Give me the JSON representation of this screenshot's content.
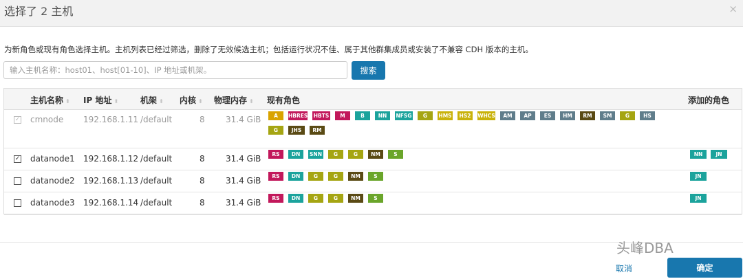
{
  "dialog": {
    "title": "选择了 2 主机",
    "close_icon": "×"
  },
  "description": "为新角色或现有角色选择主机。主机列表已经过筛选，删除了无效候选主机；包括运行状况不佳、属于其他群集成员或安装了不兼容 CDH 版本的主机。",
  "search": {
    "placeholder": "输入主机名称：host01、host[01-10]、IP 地址或机架。",
    "value": "",
    "button": "搜索"
  },
  "table": {
    "headers": {
      "hostname": "主机名称",
      "ip": "IP 地址",
      "rack": "机架",
      "cores": "内核",
      "memory": "物理内存",
      "existing_roles": "现有角色",
      "added_roles": "添加的角色"
    },
    "sort_icon": "⬍",
    "rows": [
      {
        "checked": true,
        "disabled": true,
        "hostname": "cmnode",
        "ip": "192.168.1.11",
        "rack": "/default",
        "cores": "8",
        "memory": "31.4 GiB",
        "roles": [
          "A",
          "HBRES",
          "HBTS",
          "M",
          "B",
          "NN",
          "NFSG",
          "G",
          "HMS",
          "HS2",
          "WHCS",
          "AM",
          "AP",
          "ES",
          "HM",
          "RM",
          "SM",
          "G",
          "HS",
          "G",
          "JHS",
          "RM"
        ],
        "added": []
      },
      {
        "checked": true,
        "disabled": false,
        "hostname": "datanode1",
        "ip": "192.168.1.12",
        "rack": "/default",
        "cores": "8",
        "memory": "31.4 GiB",
        "roles": [
          "RS",
          "DN",
          "SNN",
          "G",
          "G",
          "NM",
          "S"
        ],
        "added": [
          "NN",
          "JN"
        ]
      },
      {
        "checked": false,
        "disabled": false,
        "hostname": "datanode2",
        "ip": "192.168.1.13",
        "rack": "/default",
        "cores": "8",
        "memory": "31.4 GiB",
        "roles": [
          "RS",
          "DN",
          "G",
          "G",
          "NM",
          "S"
        ],
        "added": [
          "JN"
        ]
      },
      {
        "checked": false,
        "disabled": false,
        "hostname": "datanode3",
        "ip": "192.168.1.14",
        "rack": "/default",
        "cores": "8",
        "memory": "31.4 GiB",
        "roles": [
          "RS",
          "DN",
          "G",
          "G",
          "NM",
          "S"
        ],
        "added": [
          "JN"
        ]
      }
    ]
  },
  "role_colors": {
    "A": "#d9a300",
    "HBRES": "#c2185b",
    "HBTS": "#c2185b",
    "M": "#c2185b",
    "B": "#1ba39c",
    "NN": "#1ba39c",
    "NFSG": "#1ba39c",
    "SNN": "#1ba39c",
    "DN": "#1ba39c",
    "JN": "#1ba39c",
    "G": "#a5a512",
    "HMS": "#c9b20a",
    "HS2": "#c9b20a",
    "WHCS": "#c9b20a",
    "AM": "#607d8b",
    "AP": "#607d8b",
    "ES": "#607d8b",
    "HM": "#607d8b",
    "SM": "#607d8b",
    "HS": "#607d8b",
    "RM": "#5a4a14",
    "JHS": "#5a4a14",
    "NM": "#5a4a14",
    "RS": "#c2185b",
    "S": "#6aa52a"
  },
  "footer": {
    "watermark": "头峰DBA",
    "cancel": "取消",
    "confirm": "确定"
  }
}
